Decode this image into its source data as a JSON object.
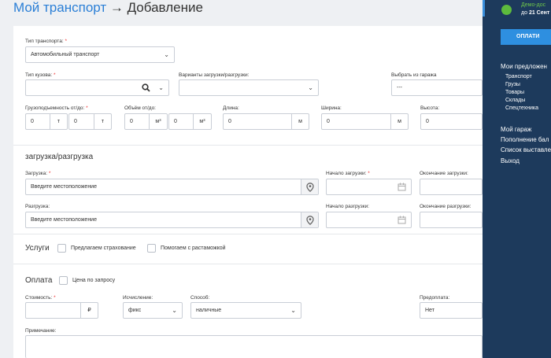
{
  "header": {
    "title_link": "Мой транспорт",
    "title_rest": "→ Добавление"
  },
  "form": {
    "transport_type": {
      "label": "Тип транспорта:",
      "value": "Автомобильный транспорт"
    },
    "body_type": {
      "label": "Тип кузова:"
    },
    "loading_variants": {
      "label": "Варианты загрузки/разгрузки:"
    },
    "garage": {
      "label": "Выбрать из гаража",
      "value": "---"
    },
    "capacity": {
      "label": "Грузоподъемность от/до:",
      "from": "0",
      "to": "0",
      "unit": "т"
    },
    "volume": {
      "label": "Объём от/до:",
      "from": "0",
      "to": "0",
      "unit": "м³"
    },
    "length": {
      "label": "Длина:",
      "value": "0",
      "unit": "м"
    },
    "width": {
      "label": "Ширина:",
      "value": "0",
      "unit": "м"
    },
    "height": {
      "label": "Высота:",
      "value": "0"
    },
    "section_loading": "загрузка/разгрузка",
    "loading": {
      "label": "Загрузка:",
      "placeholder": "Введите местоположение"
    },
    "loading_start": {
      "label": "Начало загрузки:"
    },
    "loading_end": {
      "label": "Окончание загрузки:"
    },
    "unloading": {
      "label": "Разгрузка:",
      "placeholder": "Введите местоположение"
    },
    "unloading_start": {
      "label": "Начало разгрузки:"
    },
    "unloading_end": {
      "label": "Окончание разгрузки:"
    },
    "services": {
      "title": "Услуги",
      "insurance": "Предлагаем страхование",
      "customs": "Помогаем с растаможкой"
    },
    "payment": {
      "title": "Оплата",
      "price_on_request": "Цена по запросу"
    },
    "cost": {
      "label": "Стоимость:",
      "unit": "₽"
    },
    "calculation": {
      "label": "Исчисление:",
      "value": "фикс"
    },
    "method": {
      "label": "Способ:",
      "value": "наличные"
    },
    "prepayment": {
      "label": "Предоплата:",
      "value": "Нет"
    },
    "note": {
      "label": "Примечание:"
    }
  },
  "sidebar": {
    "demo_title": "Демо-дос",
    "demo_until_prefix": "до",
    "demo_until_date": "21 Сент",
    "pay_button": "ОПЛАТИ",
    "offers_title": "Мои предложен",
    "offers": [
      "Транспорт",
      "Грузы",
      "Товары",
      "Склады",
      "Спецтехника"
    ],
    "menu": [
      "Мой гараж",
      "Пополнение бал",
      "Список выставле",
      "Выход"
    ]
  },
  "colors": {
    "accent": "#2b7fd6",
    "sidebar_bg": "#1d3a5c",
    "pay_button": "#2e8fe0",
    "required": "#ee3333",
    "status": "#5dbb3d"
  }
}
